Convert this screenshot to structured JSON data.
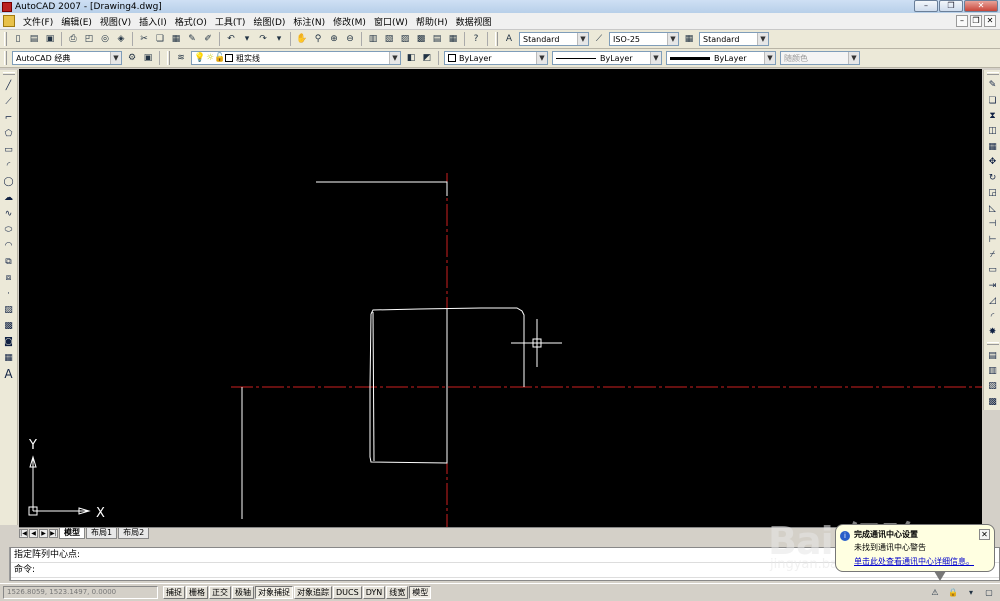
{
  "window": {
    "title": "AutoCAD 2007 - [Drawing4.dwg]",
    "minimize_label": "–",
    "restore_label": "❐",
    "close_label": "✕"
  },
  "menubar": {
    "items": [
      "文件(F)",
      "编辑(E)",
      "视图(V)",
      "插入(I)",
      "格式(O)",
      "工具(T)",
      "绘图(D)",
      "标注(N)",
      "修改(M)",
      "窗口(W)",
      "帮助(H)",
      "数据视图"
    ]
  },
  "toolbar_standard": {
    "text_style": "Standard",
    "dim_style": "ISO-25",
    "table_style": "Standard"
  },
  "toolbar_layers": {
    "workspace": "AutoCAD 经典",
    "layer": "粗实线",
    "color": "ByLayer",
    "linetype": "ByLayer",
    "lineweight": "ByLayer",
    "plot_style": "随颜色"
  },
  "layout_tabs": {
    "nav": [
      "|◀",
      "◀",
      "▶",
      "▶|"
    ],
    "tabs": [
      "模型",
      "布局1",
      "布局2"
    ],
    "active": "模型"
  },
  "command": {
    "history": "指定阵列中心点:",
    "prompt": "命令:"
  },
  "statusbar": {
    "coords": "1526.8059, 1523.1497, 0.0000",
    "buttons": [
      {
        "label": "捕捉",
        "on": false
      },
      {
        "label": "栅格",
        "on": false
      },
      {
        "label": "正交",
        "on": false
      },
      {
        "label": "极轴",
        "on": false
      },
      {
        "label": "对象捕捉",
        "on": true
      },
      {
        "label": "对象追踪",
        "on": false
      },
      {
        "label": "DUCS",
        "on": false
      },
      {
        "label": "DYN",
        "on": false
      },
      {
        "label": "线宽",
        "on": false
      },
      {
        "label": "模型",
        "on": true
      }
    ]
  },
  "notification": {
    "title": "完成通讯中心设置",
    "message": "未找到通讯中心警告",
    "link": "单击此处查看通讯中心详细信息。",
    "close_label": "✕"
  },
  "ucs": {
    "x_label": "X",
    "y_label": "Y"
  },
  "watermark": {
    "main": "Bai 经验",
    "sub": "jingyan.baidu.com"
  },
  "colors": {
    "canvas_bg": "#000000",
    "centerline": "#cc2020",
    "geometry": "#ffffff",
    "ui_bg": "#d4d0c8",
    "balloon_bg": "#ffffe1"
  },
  "icons": {
    "left_palette": [
      "line-icon",
      "construction-line-icon",
      "polyline-icon",
      "polygon-icon",
      "rectangle-icon",
      "arc-icon",
      "circle-icon",
      "revision-cloud-icon",
      "spline-icon",
      "ellipse-icon",
      "ellipse-arc-icon",
      "insert-block-icon",
      "make-block-icon",
      "point-icon",
      "hatch-icon",
      "gradient-icon",
      "region-icon",
      "table-icon",
      "multiline-text-icon"
    ],
    "right_palette": [
      "erase-icon",
      "copy-icon",
      "mirror-icon",
      "offset-icon",
      "array-icon",
      "move-icon",
      "rotate-icon",
      "scale-icon",
      "stretch-icon",
      "trim-icon",
      "extend-icon",
      "break-at-point-icon",
      "break-icon",
      "join-icon",
      "chamfer-icon",
      "fillet-icon",
      "explode-icon"
    ]
  }
}
